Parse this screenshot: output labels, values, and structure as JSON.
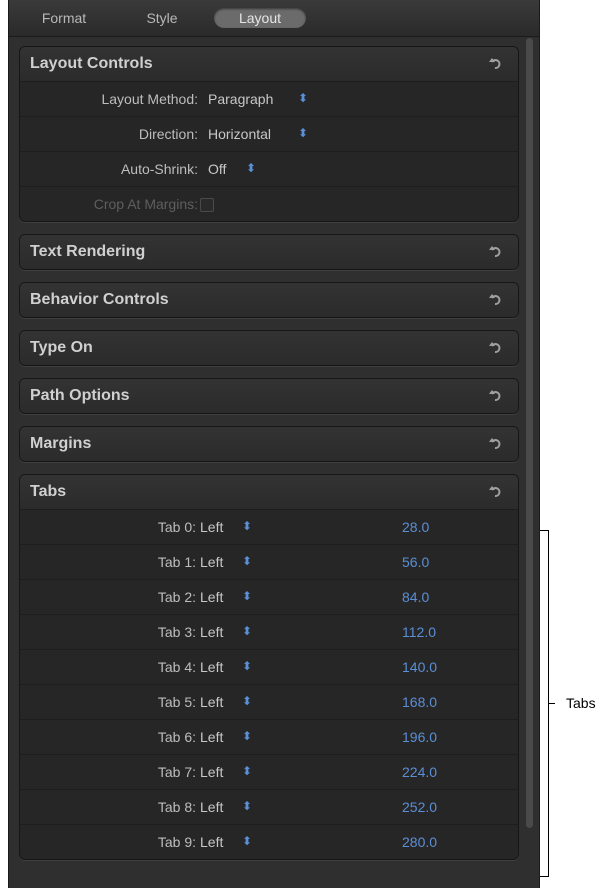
{
  "tabs": [
    {
      "label": "Format",
      "active": false
    },
    {
      "label": "Style",
      "active": false
    },
    {
      "label": "Layout",
      "active": true
    }
  ],
  "groups": {
    "layout_controls": {
      "title": "Layout Controls",
      "rows": [
        {
          "label": "Layout Method:",
          "value": "Paragraph"
        },
        {
          "label": "Direction:",
          "value": "Horizontal"
        },
        {
          "label": "Auto-Shrink:",
          "value": "Off"
        },
        {
          "label": "Crop At Margins:",
          "value": ""
        }
      ]
    },
    "text_rendering": {
      "title": "Text Rendering"
    },
    "behavior_controls": {
      "title": "Behavior Controls"
    },
    "type_on": {
      "title": "Type On"
    },
    "path_options": {
      "title": "Path Options"
    },
    "margins": {
      "title": "Margins"
    },
    "tabs_group": {
      "title": "Tabs",
      "rows": [
        {
          "label": "Tab 0:",
          "align": "Left",
          "value": "28.0"
        },
        {
          "label": "Tab 1:",
          "align": "Left",
          "value": "56.0"
        },
        {
          "label": "Tab 2:",
          "align": "Left",
          "value": "84.0"
        },
        {
          "label": "Tab 3:",
          "align": "Left",
          "value": "112.0"
        },
        {
          "label": "Tab 4:",
          "align": "Left",
          "value": "140.0"
        },
        {
          "label": "Tab 5:",
          "align": "Left",
          "value": "168.0"
        },
        {
          "label": "Tab 6:",
          "align": "Left",
          "value": "196.0"
        },
        {
          "label": "Tab 7:",
          "align": "Left",
          "value": "224.0"
        },
        {
          "label": "Tab 8:",
          "align": "Left",
          "value": "252.0"
        },
        {
          "label": "Tab 9:",
          "align": "Left",
          "value": "280.0"
        }
      ]
    }
  },
  "callout": {
    "label": "Tabs"
  },
  "icons": {
    "reset": "reset-arrow-icon",
    "stepper": "up-down-stepper-icon",
    "checkbox": "checkbox-icon"
  },
  "colors": {
    "panel": "#2f2f2f",
    "accent": "#5b8fd6",
    "text": "#d0d0d0"
  }
}
